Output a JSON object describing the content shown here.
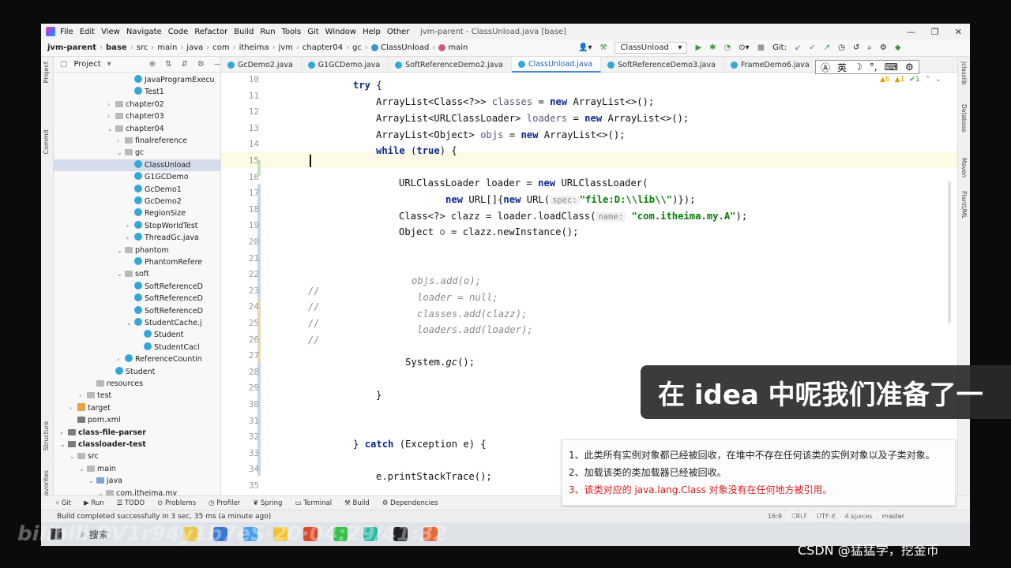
{
  "menubar": {
    "items": [
      "File",
      "Edit",
      "View",
      "Navigate",
      "Code",
      "Refactor",
      "Build",
      "Run",
      "Tools",
      "Git",
      "Window",
      "Help",
      "Other"
    ],
    "title": "jvm-parent - ClassUnload.java [base]",
    "min": "—",
    "max": "❐",
    "close": "✕"
  },
  "breadcrumbs": [
    "jvm-parent",
    "base",
    "src",
    "main",
    "java",
    "com",
    "itheima",
    "jvm",
    "chapter04",
    "gc",
    "ClassUnload",
    "main"
  ],
  "navbar": {
    "run_config": "ClassUnload",
    "git_label": "Git:"
  },
  "project": {
    "title": "Project",
    "tree": [
      {
        "label": "JavaProgramExecu",
        "indent": 8,
        "icon": "class",
        "arrow": ""
      },
      {
        "label": "Test1",
        "indent": 8,
        "icon": "class",
        "arrow": ""
      },
      {
        "label": "chapter02",
        "indent": 6,
        "icon": "folder",
        "arrow": "›"
      },
      {
        "label": "chapter03",
        "indent": 6,
        "icon": "folder",
        "arrow": "›"
      },
      {
        "label": "chapter04",
        "indent": 6,
        "icon": "folder",
        "arrow": "⌄"
      },
      {
        "label": "finalreference",
        "indent": 7,
        "icon": "folder",
        "arrow": "›"
      },
      {
        "label": "gc",
        "indent": 7,
        "icon": "folder",
        "arrow": "⌄"
      },
      {
        "label": "ClassUnload",
        "indent": 8,
        "icon": "class",
        "arrow": "",
        "selected": true
      },
      {
        "label": "G1GCDemo",
        "indent": 8,
        "icon": "class",
        "arrow": ""
      },
      {
        "label": "GcDemo1",
        "indent": 8,
        "icon": "class",
        "arrow": ""
      },
      {
        "label": "GcDemo2",
        "indent": 8,
        "icon": "class",
        "arrow": ""
      },
      {
        "label": "RegionSize",
        "indent": 8,
        "icon": "class",
        "arrow": ""
      },
      {
        "label": "StopWorldTest",
        "indent": 8,
        "icon": "class",
        "arrow": "›"
      },
      {
        "label": "ThreadGc.java",
        "indent": 8,
        "icon": "class",
        "arrow": "›"
      },
      {
        "label": "phantom",
        "indent": 7,
        "icon": "folder",
        "arrow": "⌄"
      },
      {
        "label": "PhantomRefere",
        "indent": 8,
        "icon": "class",
        "arrow": ""
      },
      {
        "label": "soft",
        "indent": 7,
        "icon": "folder",
        "arrow": "⌄"
      },
      {
        "label": "SoftReferenceD",
        "indent": 8,
        "icon": "class",
        "arrow": ""
      },
      {
        "label": "SoftReferenceD",
        "indent": 8,
        "icon": "class",
        "arrow": ""
      },
      {
        "label": "SoftReferenceD",
        "indent": 8,
        "icon": "class",
        "arrow": ""
      },
      {
        "label": "StudentCache.j",
        "indent": 8,
        "icon": "class",
        "arrow": "⌄"
      },
      {
        "label": "Student",
        "indent": 9,
        "icon": "class",
        "arrow": ""
      },
      {
        "label": "StudentCacl",
        "indent": 9,
        "icon": "class",
        "arrow": ""
      },
      {
        "label": "ReferenceCountin",
        "indent": 7,
        "icon": "class",
        "arrow": "›"
      },
      {
        "label": "Student",
        "indent": 6,
        "icon": "class",
        "arrow": ""
      },
      {
        "label": "resources",
        "indent": 4,
        "icon": "folder",
        "arrow": ""
      },
      {
        "label": "test",
        "indent": 3,
        "icon": "folder",
        "arrow": "›"
      },
      {
        "label": "target",
        "indent": 2,
        "icon": "xml",
        "arrow": "›"
      },
      {
        "label": "pom.xml",
        "indent": 2,
        "icon": "mod",
        "arrow": ""
      },
      {
        "label": "class-file-parser",
        "indent": 1,
        "icon": "mod",
        "arrow": "›",
        "bold": true
      },
      {
        "label": "classloader-test",
        "indent": 1,
        "icon": "mod",
        "arrow": "⌄",
        "bold": true
      },
      {
        "label": "src",
        "indent": 2,
        "icon": "folder",
        "arrow": "⌄"
      },
      {
        "label": "main",
        "indent": 3,
        "icon": "folder",
        "arrow": "⌄"
      },
      {
        "label": "java",
        "indent": 4,
        "icon": "src",
        "arrow": "⌄"
      },
      {
        "label": "com.itheima.my",
        "indent": 5,
        "icon": "folder",
        "arrow": "⌄"
      }
    ]
  },
  "tabs": [
    {
      "label": "GcDemo2.java"
    },
    {
      "label": "G1GCDemo.java"
    },
    {
      "label": "SoftReferenceDemo2.java"
    },
    {
      "label": "ClassUnload.java",
      "active": true
    },
    {
      "label": "SoftReferenceDemo3.java"
    },
    {
      "label": "FrameDemo6.java"
    }
  ],
  "ime": {
    "mode": "英"
  },
  "inspections": {
    "warnings": "▲6",
    "weak": "▲1",
    "typos": "✔1"
  },
  "code": {
    "line_numbers": [
      "10",
      "11",
      "12",
      "13",
      "14",
      "15",
      "16",
      "17",
      "18",
      "19",
      "20",
      "21",
      "22",
      "23",
      "24",
      "25",
      "26",
      "27",
      "28",
      "29",
      "30",
      "31",
      "32",
      "33",
      "34",
      "35"
    ],
    "comment_slashes": [
      "//",
      "//",
      "//",
      "//"
    ],
    "l11_kw": "try",
    "l11_rest": " {",
    "l12_a": "ArrayList<Class<?>> ",
    "l12_v": "classes",
    "l12_b": " = ",
    "l12_kw": "new",
    "l12_c": " ArrayList<>();",
    "l13_a": "ArrayList<URLClassLoader> ",
    "l13_v": "loaders",
    "l13_b": " = ",
    "l13_kw": "new",
    "l13_c": " ArrayList<>();",
    "l14_a": "ArrayList<Object> ",
    "l14_v": "objs",
    "l14_b": " = ",
    "l14_kw": "new",
    "l14_c": " ArrayList<>();",
    "l15_kw": "while",
    "l15_rest": " (",
    "l15_kw2": "true",
    "l15_end": ") {",
    "l17_a": "URLClassLoader loader = ",
    "l17_kw": "new",
    "l17_b": " URLClassLoader(",
    "l18_kw": "new",
    "l18_a": " URL[]{",
    "l18_kw2": "new",
    "l18_b": " URL(",
    "l18_hint": "spec:",
    "l18_str": "\"file:D:\\\\lib\\\\\"",
    "l18_c": ")});",
    "l19_a": "Class<?> clazz = loader.loadClass(",
    "l19_hint": "name:",
    "l19_str": "\"com.itheima.my.A\"",
    "l19_b": ");",
    "l20_a": "Object ",
    "l20_v": "o",
    "l20_b": " = clazz.newInstance();",
    "l23": "objs.add(o);",
    "l24": "loader = null;",
    "l25": "classes.add(clazz);",
    "l26": "loaders.add(loader);",
    "l27_a": "System.",
    "l27_m": "gc",
    "l27_b": "();",
    "l29": "}",
    "l33_a": "} ",
    "l33_kw": "catch",
    "l33_b": " (Exception e) {",
    "l35": "e.printStackTrace();"
  },
  "right_tools": [
    "jclasslib",
    "Database",
    "Maven",
    "PlantUML"
  ],
  "bottom_tools": [
    "Git",
    "Run",
    "TODO",
    "Problems",
    "Profiler",
    "Spring",
    "Terminal",
    "Build",
    "Dependencies"
  ],
  "status": {
    "message": "Build completed successfully in 3 sec, 35 ms (a minute ago)",
    "pos": "16:9",
    "crlf": "CRLF",
    "enc": "UTF-8",
    "indent": "4 spaces",
    "branch": "master"
  },
  "subtitle": "在 idea 中呢我们准备了一",
  "notes": [
    {
      "text": "1、此类所有实例对象都已经被回收，在堆中不存在任何该类的实例对象以及子类对象。",
      "highlight": false
    },
    {
      "text": "2、加载该类的类加载器已经被回收。",
      "highlight": false
    },
    {
      "text": "3、该类对应的 java.lang.Class 对象没有在任何地方被引用。",
      "highlight": true
    }
  ],
  "taskbar": {
    "search": "搜索"
  },
  "watermarks": {
    "bilibili": "bilibili BV1r94y1b7eS·20·04:29/41:32",
    "heima": "黑马程序员·哔哩哔",
    "csdn": "CSDN @猛猛学，挖金币"
  },
  "colors": {
    "accent": "#4a88d8",
    "keyword": "#0b2a8f",
    "string": "#0a7a0a",
    "note_red": "#d62020"
  }
}
